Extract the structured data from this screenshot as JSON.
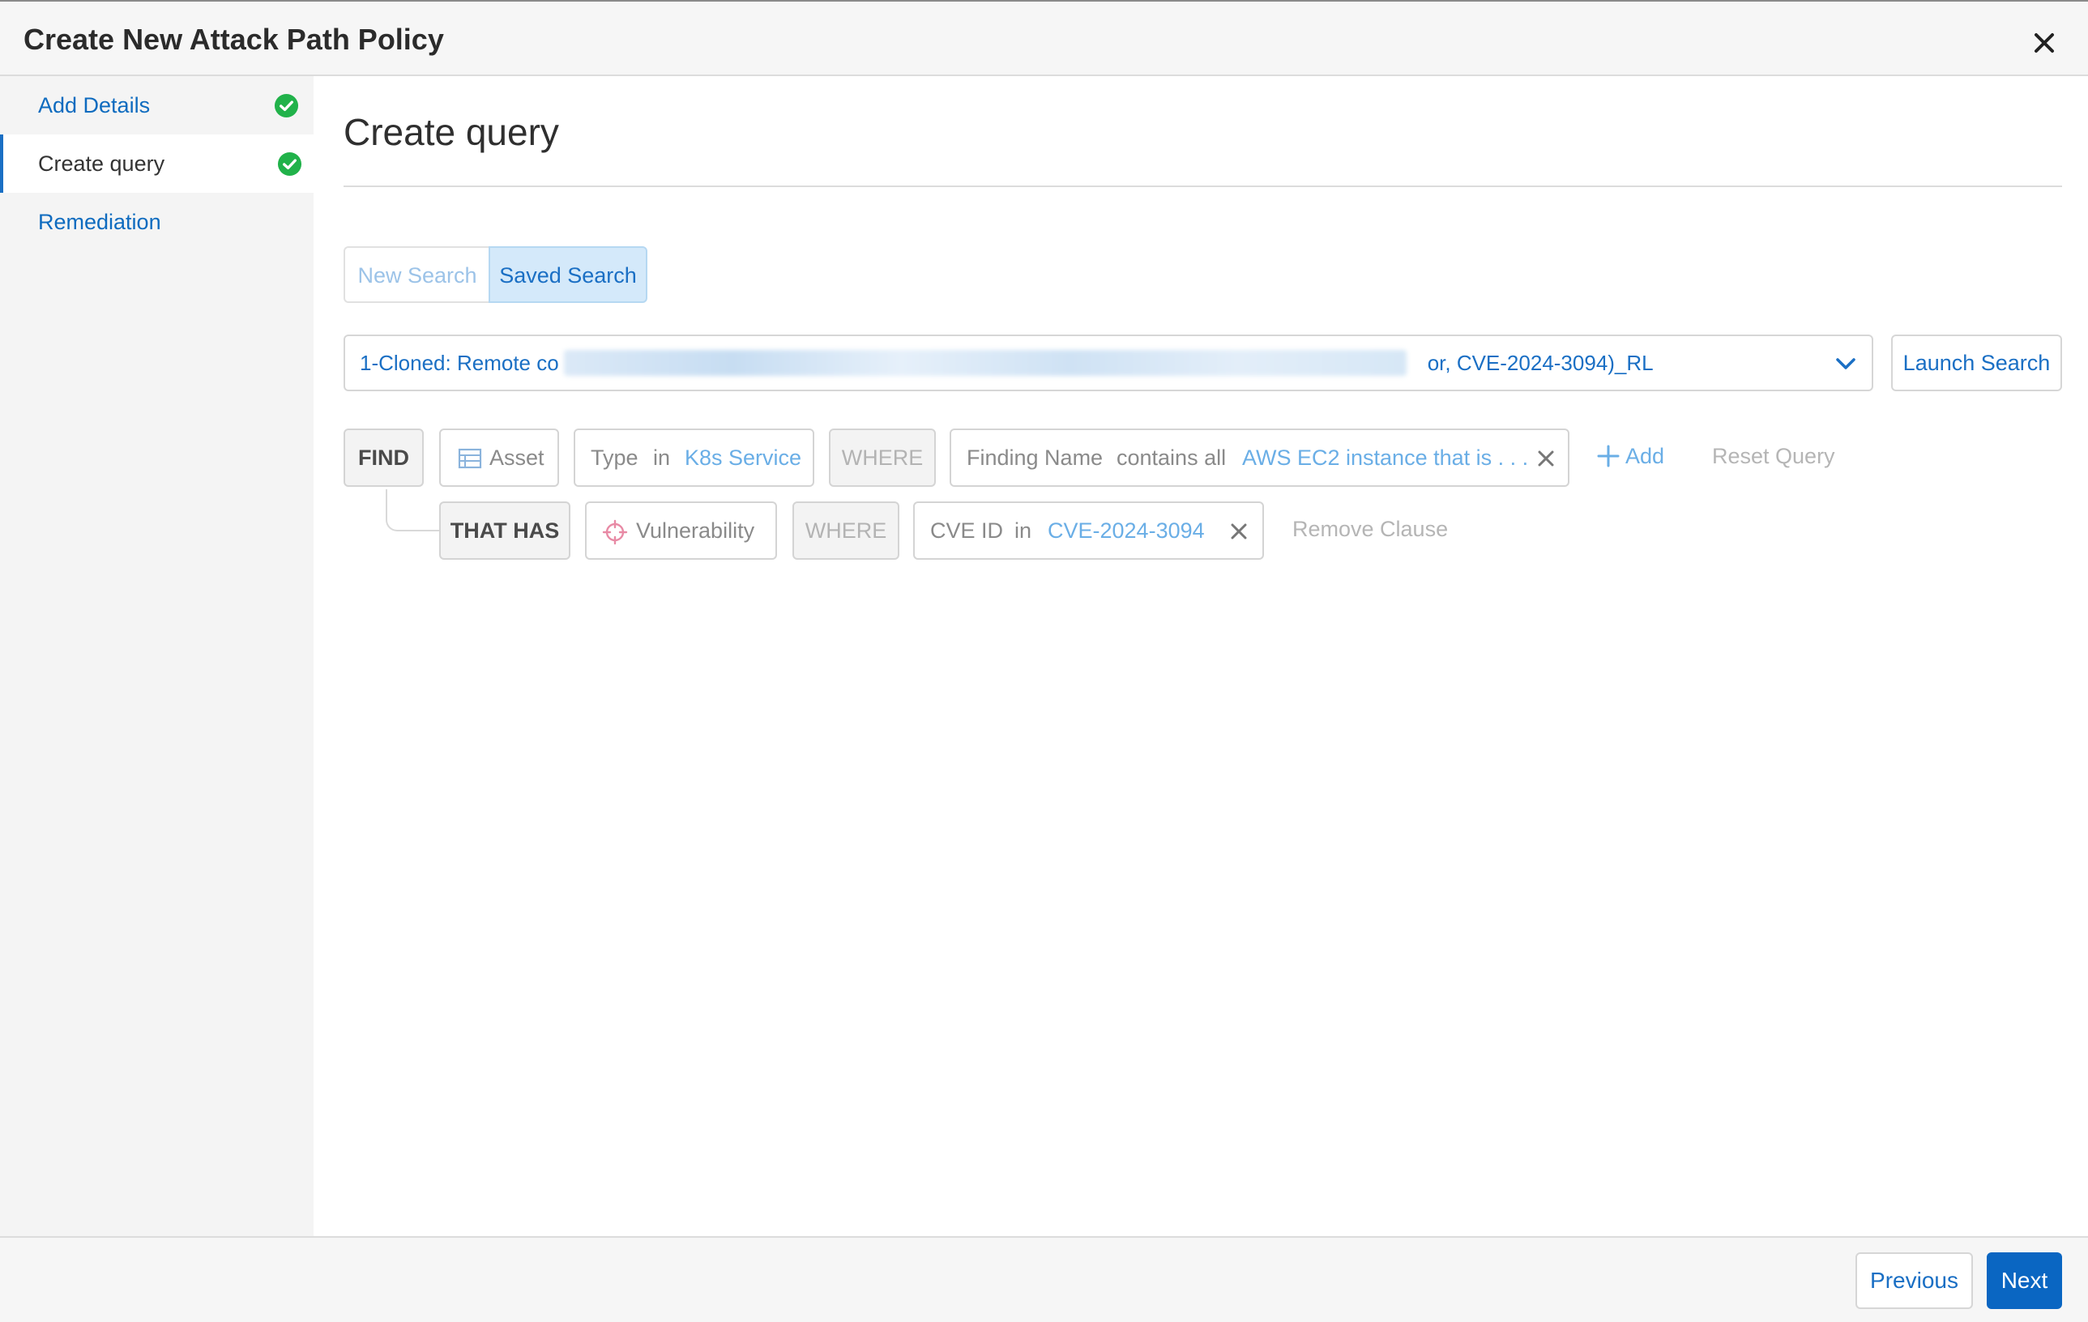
{
  "dialog": {
    "title": "Create New Attack Path Policy"
  },
  "sidebar": {
    "items": [
      {
        "label": "Add Details",
        "completed": true,
        "active": false
      },
      {
        "label": "Create query",
        "completed": true,
        "active": true
      },
      {
        "label": "Remediation",
        "completed": false,
        "active": false
      }
    ]
  },
  "main": {
    "title": "Create query",
    "search_mode": {
      "new_label": "New Search",
      "saved_label": "Saved Search",
      "selected": "Saved Search"
    },
    "saved_search": {
      "value_prefix": "1-Cloned: Remote co",
      "value_suffix": "or, CVE-2024-3094)_RL",
      "launch_label": "Launch Search"
    },
    "query": {
      "find": {
        "keyword": "FIND",
        "entity": "Asset",
        "type_label": "Type",
        "type_op": "in",
        "type_value": "K8s Service",
        "where": "WHERE",
        "cond_label": "Finding Name",
        "cond_op": "contains all",
        "cond_value": "AWS EC2 instance that is . . .",
        "add_label": "Add",
        "reset_label": "Reset Query"
      },
      "that_has": {
        "keyword": "THAT HAS",
        "entity": "Vulnerability",
        "where": "WHERE",
        "cond_label": "CVE ID",
        "cond_op": "in",
        "cond_value": "CVE-2024-3094",
        "remove_label": "Remove Clause"
      }
    }
  },
  "footer": {
    "previous_label": "Previous",
    "next_label": "Next"
  },
  "colors": {
    "accent": "#0a66c2",
    "link": "#1a6fc4",
    "success": "#21b24a"
  }
}
